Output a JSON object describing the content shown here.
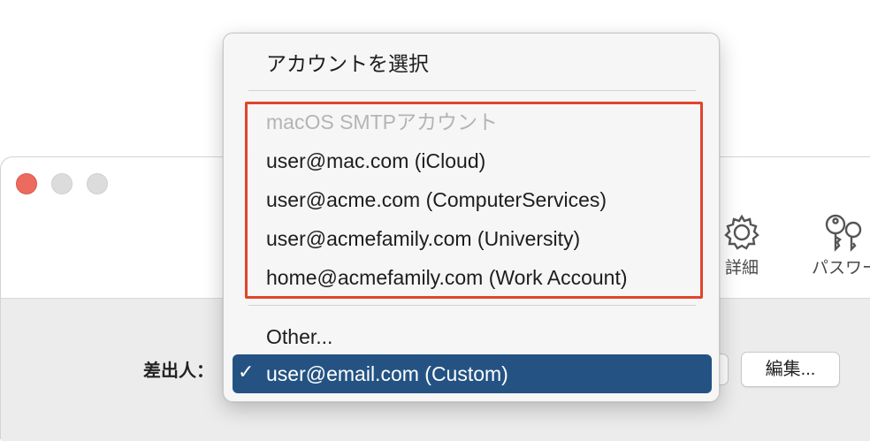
{
  "window": {
    "toolbar": {
      "advanced_label": "詳細",
      "passwords_label": "パスワー",
      "advanced_icon": "gear-icon",
      "passwords_icon": "key-icon"
    },
    "sender_label": "差出人：",
    "edit_button_label": "編集..."
  },
  "menu": {
    "header": "アカウントを選択",
    "group_title": "macOS SMTPアカウント",
    "accounts": [
      "user@mac.com (iCloud)",
      "user@acme.com (ComputerServices)",
      "user@acmefamily.com (University)",
      "home@acmefamily.com (Work Account)"
    ],
    "other": "Other...",
    "selected": "user@email.com (Custom)",
    "selected_mark": "✓"
  },
  "colors": {
    "selection": "#245383",
    "highlight": "#e0452b",
    "close_button": "#ed6a5e"
  }
}
